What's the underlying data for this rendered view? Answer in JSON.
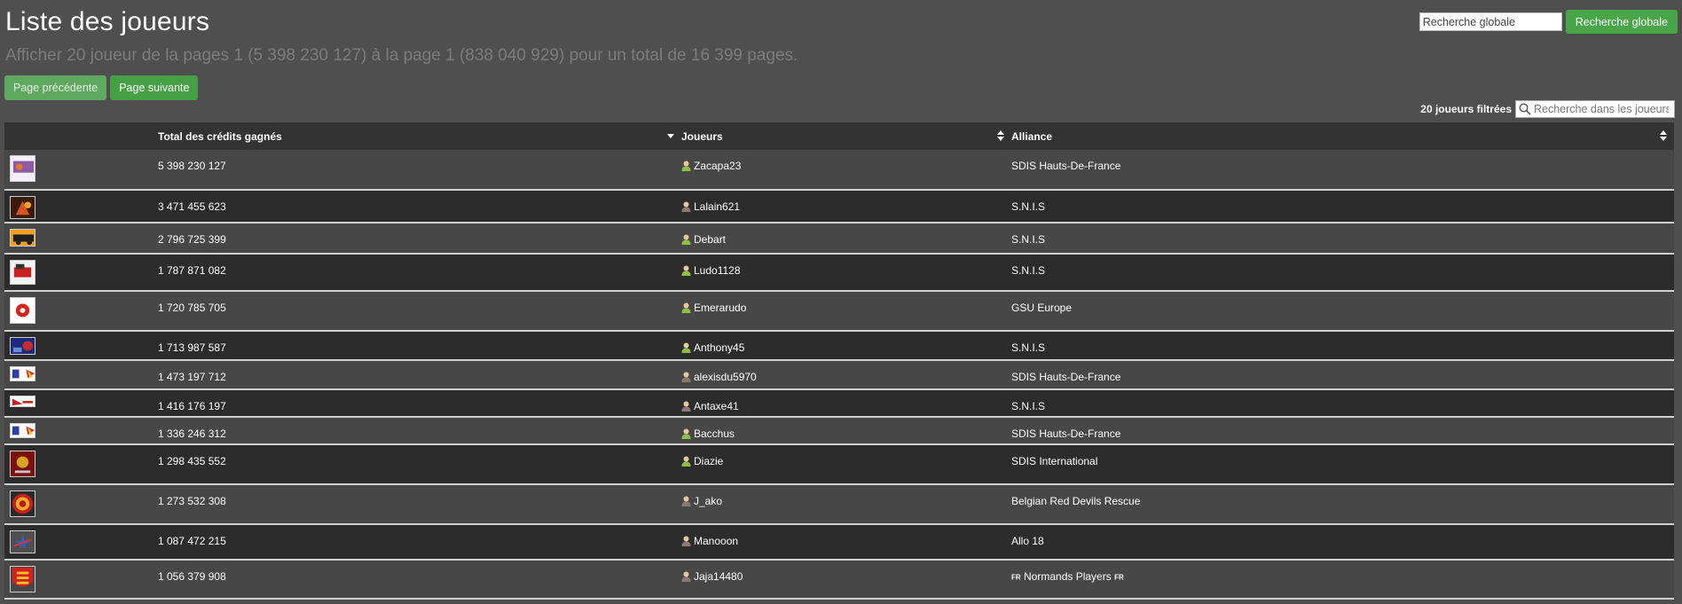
{
  "header": {
    "title": "Liste des joueurs",
    "subtitle": "Afficher 20 joueur de la pages 1 (5 398 230 127) à la page 1 (838 040 929) pour un total de 16 399 pages."
  },
  "nav": {
    "prev_label": "Page précédente",
    "next_label": "Page suivante"
  },
  "global_search": {
    "placeholder": "Recherche globale",
    "value": "",
    "button_label": "Recherche globale"
  },
  "filter": {
    "count_label": "20 joueurs filtrées",
    "placeholder": "Recherche dans les joueurs",
    "value": ""
  },
  "table": {
    "columns": {
      "logo": "",
      "credits": "Total des crédits gagnés",
      "players": "Joueurs",
      "alliance": "Alliance"
    },
    "rows": [
      {
        "logo_icon": "alliance-logo-icon",
        "credits": "5 398 230 127",
        "player": "Zacapa23",
        "alliance": "SDIS Hauts-De-France",
        "status": "green",
        "flag_before": "",
        "flag_after": ""
      },
      {
        "logo_icon": "fire-logo-icon",
        "credits": "3 471 455 623",
        "player": "Lalain621",
        "alliance": "S.N.I.S",
        "status": "grey",
        "flag_before": "",
        "flag_after": ""
      },
      {
        "logo_icon": "fire-truck-logo-icon",
        "credits": "2 796 725 399",
        "player": "Debart",
        "alliance": "S.N.I.S",
        "status": "green",
        "flag_before": "",
        "flag_after": ""
      },
      {
        "logo_icon": "truck-logo-icon",
        "credits": "1 787 871 082",
        "player": "Ludo1128",
        "alliance": "S.N.I.S",
        "status": "green",
        "flag_before": "",
        "flag_after": ""
      },
      {
        "logo_icon": "emblem-logo-icon",
        "credits": "1 720 785 705",
        "player": "Emerarudo",
        "alliance": "GSU Europe",
        "status": "green",
        "flag_before": "",
        "flag_after": ""
      },
      {
        "logo_icon": "police-logo-icon",
        "credits": "1 713 987 587",
        "player": "Anthony45",
        "alliance": "S.N.I.S",
        "status": "green",
        "flag_before": "",
        "flag_after": ""
      },
      {
        "logo_icon": "france-logo-icon",
        "credits": "1 473 197 712",
        "player": "alexisdu5970",
        "alliance": "SDIS Hauts-De-France",
        "status": "grey",
        "flag_before": "",
        "flag_after": ""
      },
      {
        "logo_icon": "banner-logo-icon",
        "credits": "1 416 176 197",
        "player": "Antaxe41",
        "alliance": "S.N.I.S",
        "status": "grey",
        "flag_before": "",
        "flag_after": ""
      },
      {
        "logo_icon": "france-logo-icon",
        "credits": "1 336 246 312",
        "player": "Bacchus",
        "alliance": "SDIS Hauts-De-France",
        "status": "green",
        "flag_before": "",
        "flag_after": ""
      },
      {
        "logo_icon": "international-logo-icon",
        "credits": "1 298 435 552",
        "player": "Diazie",
        "alliance": "SDIS International",
        "status": "green",
        "flag_before": "",
        "flag_after": ""
      },
      {
        "logo_icon": "devils-logo-icon",
        "credits": "1 273 532 308",
        "player": "J_ako",
        "alliance": "Belgian Red Devils Rescue",
        "status": "grey",
        "flag_before": "",
        "flag_after": ""
      },
      {
        "logo_icon": "star-logo-icon",
        "credits": "1 087 472 215",
        "player": "Manooon",
        "alliance": "Allo 18",
        "status": "grey",
        "flag_before": "",
        "flag_after": ""
      },
      {
        "logo_icon": "normandy-shield-logo-icon",
        "credits": "1 056 379 908",
        "player": "Jaja14480",
        "alliance": "Normands Players",
        "status": "grey",
        "flag_before": "FR",
        "flag_after": "FR"
      }
    ]
  },
  "colors": {
    "page_bg": "#4f4f4f",
    "row_light": "#474747",
    "row_dark": "#2c2c2c",
    "header_bg": "#333333",
    "button_green": "#45a045",
    "status_online": "#8fc044",
    "status_offline": "#8a7a70"
  }
}
